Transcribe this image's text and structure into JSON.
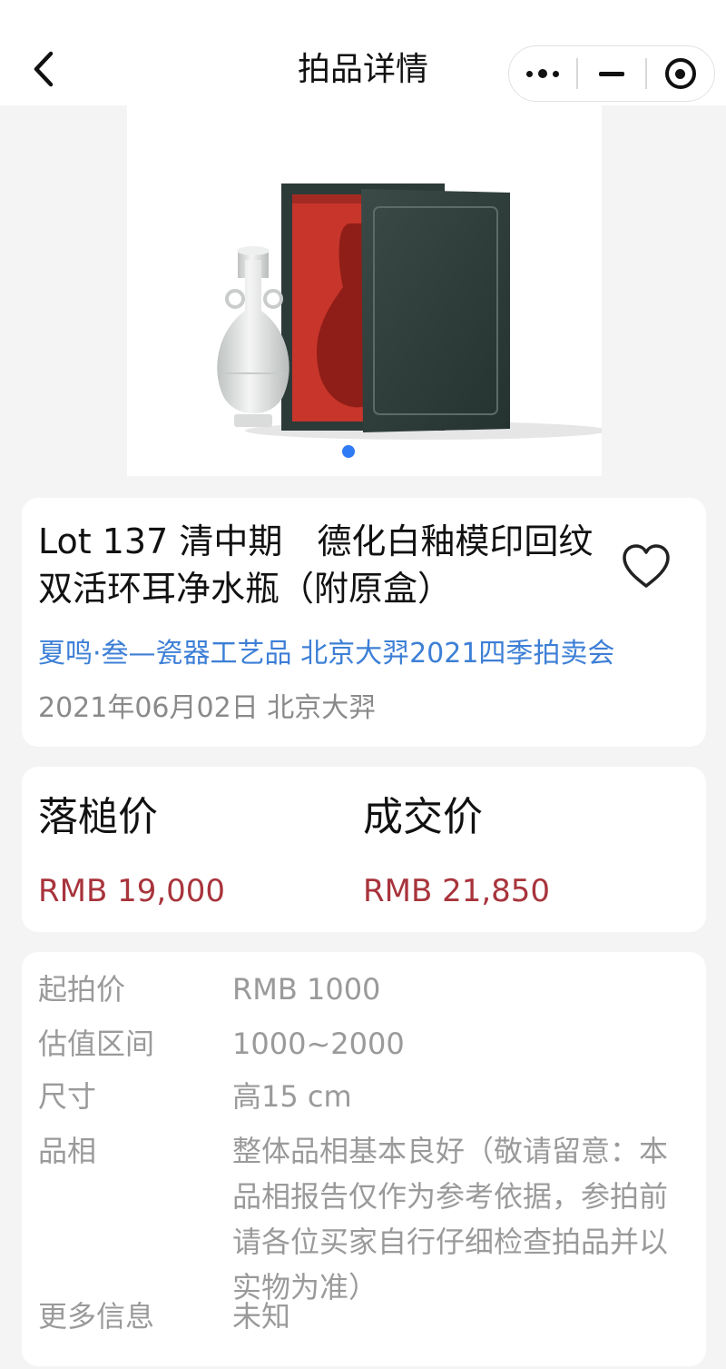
{
  "nav": {
    "title": "拍品详情"
  },
  "gallery": {
    "page_count": 1,
    "current_page": 1,
    "accent_color": "#2f7bf5"
  },
  "lot": {
    "title": "Lot 137 清中期　德化白釉模印回纹双活环耳净水瓶（附原盒）",
    "auction": "夏鸣·叁—瓷器工艺品 北京大羿2021四季拍卖会",
    "date_house": "2021年06月02日 北京大羿",
    "favorited": false
  },
  "prices": {
    "hammer_label": "落槌价",
    "hammer_value": "RMB 19,000",
    "deal_label": "成交价",
    "deal_value": "RMB 21,850",
    "value_color": "#a8343c"
  },
  "details": [
    {
      "key": "起拍价",
      "value": "RMB 1000"
    },
    {
      "key": "估值区间",
      "value": "1000~2000"
    },
    {
      "key": "尺寸",
      "value": "高15 cm"
    },
    {
      "key": "品相",
      "value": "整体品相基本良好（敬请留意：本品相报告仅作为参考依据，参拍前请各位买家自行仔细检查拍品并以实物为准）"
    },
    {
      "key": "更多信息",
      "value": "未知"
    }
  ]
}
